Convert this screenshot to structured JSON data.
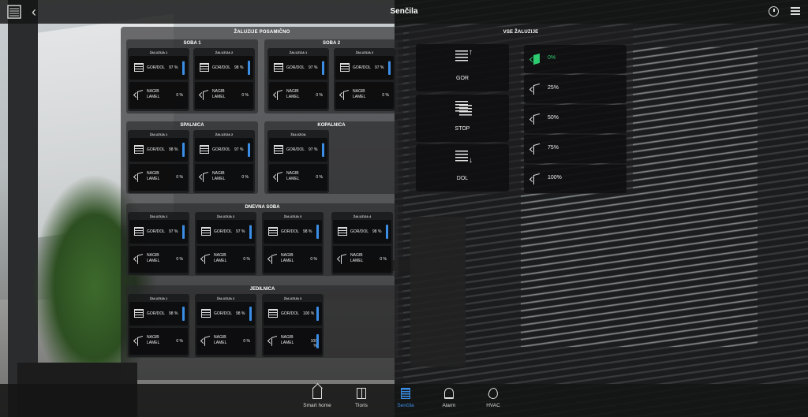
{
  "app": {
    "title": "Senčila"
  },
  "left_panel": {
    "title": "ŽALUZIJE POSAMIČNO",
    "groups": [
      {
        "name": "SOBA 1",
        "cards": [
          {
            "title": "ŽALUZIJA 1",
            "gor_label": "GOR/DOL",
            "pct": "97 %",
            "level": 0.97,
            "nagib_label": "NAGIB LAMEL",
            "tilt": "0 %",
            "tilt_level": 0
          },
          {
            "title": "ŽALUZIJA 2",
            "gor_label": "GOR/DOL",
            "pct": "98 %",
            "level": 0.98,
            "nagib_label": "NAGIB LAMEL",
            "tilt": "0 %",
            "tilt_level": 0
          }
        ]
      },
      {
        "name": "SOBA 2",
        "cards": [
          {
            "title": "ŽALUZIJA 1",
            "gor_label": "GOR/DOL",
            "pct": "97 %",
            "level": 0.97,
            "nagib_label": "NAGIB LAMEL",
            "tilt": "0 %",
            "tilt_level": 0
          },
          {
            "title": "ŽALUZIJA 2",
            "gor_label": "GOR/DOL",
            "pct": "97 %",
            "level": 0.97,
            "nagib_label": "NAGIB LAMEL",
            "tilt": "0 %",
            "tilt_level": 0
          }
        ]
      },
      {
        "name": "SPALNICA",
        "cards": [
          {
            "title": "ŽALUZIJA 1",
            "gor_label": "GOR/DOL",
            "pct": "98 %",
            "level": 0.98,
            "nagib_label": "NAGIB LAMEL",
            "tilt": "0 %",
            "tilt_level": 0
          },
          {
            "title": "ŽALUZIJA 2",
            "gor_label": "GOR/DOL",
            "pct": "97 %",
            "level": 0.97,
            "nagib_label": "NAGIB LAMEL",
            "tilt": "0 %",
            "tilt_level": 0
          }
        ]
      },
      {
        "name": "KOPALNICA",
        "cards": [
          {
            "title": "ŽALUZIJA",
            "gor_label": "GOR/DOL",
            "pct": "97 %",
            "level": 0.97,
            "nagib_label": "NAGIB LAMEL",
            "tilt": "0 %",
            "tilt_level": 0
          }
        ]
      },
      {
        "name": "DNEVNA SOBA",
        "cards": [
          {
            "title": "ŽALUZIJA 1",
            "gor_label": "GOR/DOL",
            "pct": "97 %",
            "level": 0.97,
            "nagib_label": "NAGIB LAMEL",
            "tilt": "0 %",
            "tilt_level": 0
          },
          {
            "title": "ŽALUZIJA 2",
            "gor_label": "GOR/DOL",
            "pct": "97 %",
            "level": 0.97,
            "nagib_label": "NAGIB LAMEL",
            "tilt": "0 %",
            "tilt_level": 0
          },
          {
            "title": "ŽALUZIJA 3",
            "gor_label": "GOR/DOL",
            "pct": "98 %",
            "level": 0.98,
            "nagib_label": "NAGIB LAMEL",
            "tilt": "0 %",
            "tilt_level": 0
          },
          {
            "title": "ŽALUZIJA 4",
            "gor_label": "GOR/DOL",
            "pct": "98 %",
            "level": 0.98,
            "nagib_label": "NAGIB LAMEL",
            "tilt": "0 %",
            "tilt_level": 0
          }
        ]
      },
      {
        "name": "JEDILNICA",
        "cards": [
          {
            "title": "ŽALUZIJA 1",
            "gor_label": "GOR/DOL",
            "pct": "98 %",
            "level": 0.98,
            "nagib_label": "NAGIB LAMEL",
            "tilt": "0 %",
            "tilt_level": 0
          },
          {
            "title": "ŽALUZIJA 2",
            "gor_label": "GOR/DOL",
            "pct": "98 %",
            "level": 0.98,
            "nagib_label": "NAGIB LAMEL",
            "tilt": "0 %",
            "tilt_level": 0
          },
          {
            "title": "ŽALUZIJA 3",
            "gor_label": "GOR/DOL",
            "pct": "100 %",
            "level": 1.0,
            "nagib_label": "NAGIB LAMEL",
            "tilt": "100 %",
            "tilt_level": 1.0
          }
        ]
      }
    ]
  },
  "right_panel": {
    "title": "VSE ŽALUZIJE",
    "commands": [
      {
        "label": "GOR",
        "icon": "blinds-up-icon"
      },
      {
        "label": "STOP",
        "icon": "blinds-stop-icon"
      },
      {
        "label": "DOL",
        "icon": "blinds-down-icon"
      }
    ],
    "tilts": [
      {
        "label": "0%",
        "active": true
      },
      {
        "label": "25%",
        "active": false
      },
      {
        "label": "50%",
        "active": false
      },
      {
        "label": "75%",
        "active": false
      },
      {
        "label": "100%",
        "active": false
      }
    ]
  },
  "nav": [
    {
      "label": "Smart home",
      "icon": "house-icon"
    },
    {
      "label": "Tloris",
      "icon": "floorplan-icon"
    },
    {
      "label": "Senčila",
      "icon": "blinds-icon",
      "active": true
    },
    {
      "label": "Alarm",
      "icon": "bell-icon"
    },
    {
      "label": "HVAC",
      "icon": "flame-icon"
    }
  ],
  "colors": {
    "accent": "#3a8ee6",
    "active_green": "#2ecc71"
  }
}
